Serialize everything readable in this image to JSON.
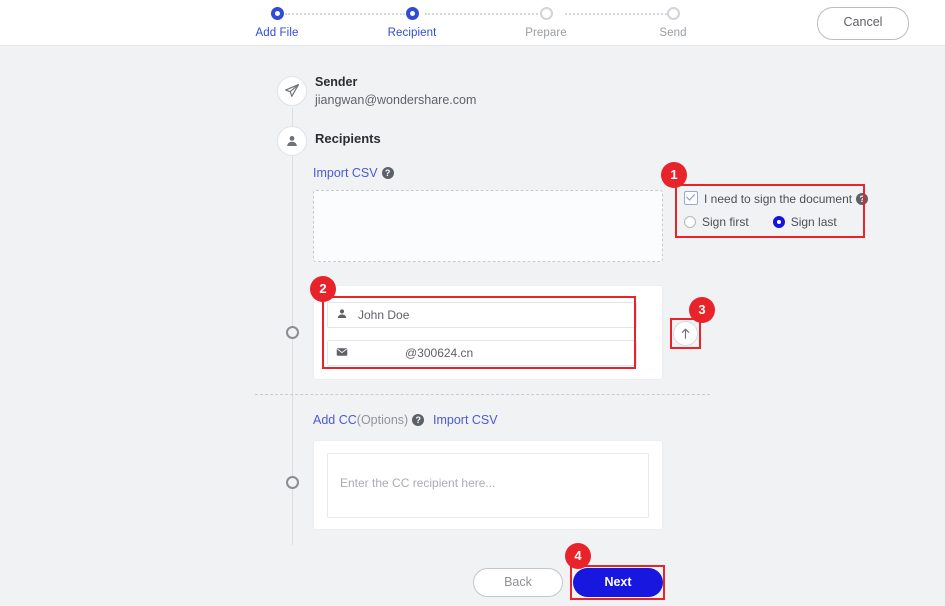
{
  "header": {
    "cancel_label": "Cancel",
    "steps": [
      {
        "label": "Add File",
        "state": "active"
      },
      {
        "label": "Recipient",
        "state": "active"
      },
      {
        "label": "Prepare",
        "state": "inactive"
      },
      {
        "label": "Send",
        "state": "inactive"
      }
    ]
  },
  "sender": {
    "icon": "send-icon",
    "title": "Sender",
    "email": "jiangwan@wondershare.com"
  },
  "recipients": {
    "icon": "person-icon",
    "title": "Recipients",
    "import_csv_label": "Import CSV",
    "help_glyph": "?",
    "dropzone_text": "",
    "sign_options": {
      "checkbox_label": "I need to sign the document",
      "checkbox_checked": true,
      "radio_first_label": "Sign first",
      "radio_last_label": "Sign last",
      "selected_radio": "Sign last"
    },
    "recipient_row": {
      "name_icon": "person-icon",
      "name_value": "John Doe",
      "email_icon": "mail-icon",
      "email_value": "@300624.cn"
    },
    "upload_icon": "upload-arrow-icon"
  },
  "cc": {
    "label_main": "Add CC",
    "label_options": "(Options)",
    "help_glyph": "?",
    "import_csv_label": "Import CSV",
    "placeholder": "Enter the CC recipient here..."
  },
  "footer": {
    "back_label": "Back",
    "next_label": "Next"
  },
  "annotations": [
    {
      "number": "1"
    },
    {
      "number": "2"
    },
    {
      "number": "3"
    },
    {
      "number": "4"
    }
  ],
  "colors": {
    "accent_blue": "#2f4bd8",
    "primary_blue": "#1717e0",
    "annotation_red": "#e8232a",
    "page_bg": "#f1f2f4"
  }
}
